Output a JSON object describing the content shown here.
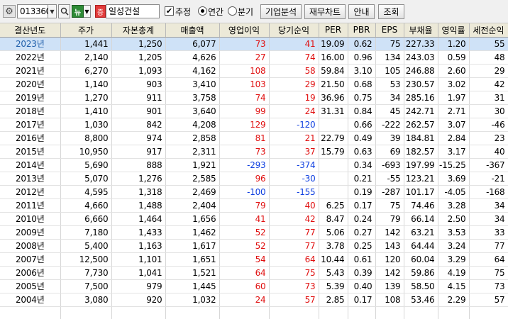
{
  "toolbar": {
    "stock_code": "013360",
    "company_name": "일성건설",
    "new_badge": "뉴",
    "market_badge": "증",
    "estimate_label": "추정",
    "estimate_checked": true,
    "period_annual_label": "연간",
    "period_quarter_label": "분기",
    "period_selected": "annual",
    "btn_company_analysis": "기업분석",
    "btn_financial_chart": "재무차트",
    "btn_guide": "안내",
    "btn_query": "조회"
  },
  "table": {
    "headers": [
      "결산년도",
      "주가",
      "자본총계",
      "매출액",
      "영업이익",
      "당기순익",
      "PER",
      "PBR",
      "EPS",
      "부채율",
      "영익률",
      "세전순익"
    ],
    "selected_row": 0,
    "rows": [
      [
        "2023년",
        "1,441",
        "1,250",
        "6,077",
        "73",
        "41",
        "19.09",
        "0.62",
        "75",
        "227.33",
        "1.20",
        "55"
      ],
      [
        "2022년",
        "2,140",
        "1,205",
        "4,626",
        "27",
        "74",
        "16.00",
        "0.96",
        "134",
        "243.03",
        "0.59",
        "48"
      ],
      [
        "2021년",
        "6,270",
        "1,093",
        "4,162",
        "108",
        "58",
        "59.84",
        "3.10",
        "105",
        "246.88",
        "2.60",
        "29"
      ],
      [
        "2020년",
        "1,140",
        "903",
        "3,410",
        "103",
        "29",
        "21.50",
        "0.68",
        "53",
        "230.57",
        "3.02",
        "42"
      ],
      [
        "2019년",
        "1,270",
        "911",
        "3,758",
        "74",
        "19",
        "36.96",
        "0.75",
        "34",
        "285.16",
        "1.97",
        "31"
      ],
      [
        "2018년",
        "1,410",
        "901",
        "3,640",
        "99",
        "24",
        "31.31",
        "0.84",
        "45",
        "242.71",
        "2.71",
        "30"
      ],
      [
        "2017년",
        "1,030",
        "842",
        "4,208",
        "129",
        "-120",
        "",
        "0.66",
        "-222",
        "262.57",
        "3.07",
        "-46"
      ],
      [
        "2016년",
        "8,800",
        "974",
        "2,858",
        "81",
        "21",
        "22.79",
        "0.49",
        "39",
        "184.81",
        "2.84",
        "23"
      ],
      [
        "2015년",
        "10,950",
        "917",
        "2,311",
        "73",
        "37",
        "15.79",
        "0.63",
        "69",
        "182.57",
        "3.17",
        "40"
      ],
      [
        "2014년",
        "5,690",
        "888",
        "1,921",
        "-293",
        "-374",
        "",
        "0.34",
        "-693",
        "197.99",
        "-15.25",
        "-367"
      ],
      [
        "2013년",
        "5,070",
        "1,276",
        "2,585",
        "96",
        "-30",
        "",
        "0.21",
        "-55",
        "123.21",
        "3.69",
        "-21"
      ],
      [
        "2012년",
        "4,595",
        "1,318",
        "2,469",
        "-100",
        "-155",
        "",
        "0.19",
        "-287",
        "101.17",
        "-4.05",
        "-168"
      ],
      [
        "2011년",
        "4,660",
        "1,488",
        "2,404",
        "79",
        "40",
        "6.25",
        "0.17",
        "75",
        "74.46",
        "3.28",
        "34"
      ],
      [
        "2010년",
        "6,660",
        "1,464",
        "1,656",
        "41",
        "42",
        "8.47",
        "0.24",
        "79",
        "66.14",
        "2.50",
        "34"
      ],
      [
        "2009년",
        "7,180",
        "1,433",
        "1,462",
        "52",
        "77",
        "5.06",
        "0.27",
        "142",
        "63.21",
        "3.53",
        "33"
      ],
      [
        "2008년",
        "5,400",
        "1,163",
        "1,617",
        "52",
        "77",
        "3.78",
        "0.25",
        "143",
        "64.44",
        "3.24",
        "77"
      ],
      [
        "2007년",
        "12,500",
        "1,101",
        "1,651",
        "54",
        "64",
        "10.44",
        "0.61",
        "120",
        "60.04",
        "3.29",
        "64"
      ],
      [
        "2006년",
        "7,730",
        "1,041",
        "1,521",
        "64",
        "75",
        "5.43",
        "0.39",
        "142",
        "59.86",
        "4.19",
        "75"
      ],
      [
        "2005년",
        "7,500",
        "979",
        "1,445",
        "60",
        "73",
        "5.39",
        "0.40",
        "139",
        "58.50",
        "4.15",
        "73"
      ],
      [
        "2004년",
        "3,080",
        "920",
        "1,032",
        "24",
        "57",
        "2.85",
        "0.17",
        "108",
        "53.46",
        "2.29",
        "57"
      ]
    ]
  },
  "colors": {
    "positive": "#e01010",
    "negative": "#1040e0",
    "selected_row_bg": "#cfe2f7",
    "header_bg": "#ece9d8"
  }
}
